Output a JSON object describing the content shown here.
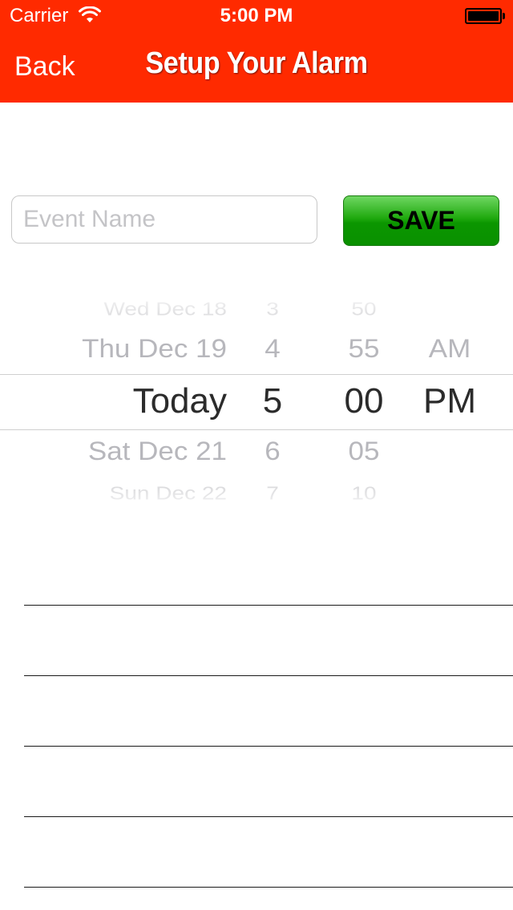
{
  "status_bar": {
    "carrier": "Carrier",
    "time": "5:00 PM"
  },
  "nav": {
    "back_label": "Back",
    "title": "Setup Your Alarm"
  },
  "form": {
    "event_placeholder": "Event Name",
    "event_value": "",
    "save_label": "SAVE"
  },
  "picker": {
    "date": [
      "Wed Dec 18",
      "Thu Dec 19",
      "Today",
      "Sat Dec 21",
      "Sun Dec 22"
    ],
    "hour": [
      "3",
      "4",
      "5",
      "6",
      "7"
    ],
    "minute": [
      "50",
      "55",
      "00",
      "05",
      "10"
    ],
    "ampm": [
      "AM",
      "PM"
    ],
    "selected": {
      "date": "Today",
      "hour": "5",
      "minute": "00",
      "ampm": "PM"
    }
  },
  "colors": {
    "nav_background": "#ff2a00",
    "save_button": "#0a9600",
    "nav_text": "#ffffff"
  },
  "icons": {
    "wifi": "wifi-icon",
    "battery": "battery-icon"
  }
}
